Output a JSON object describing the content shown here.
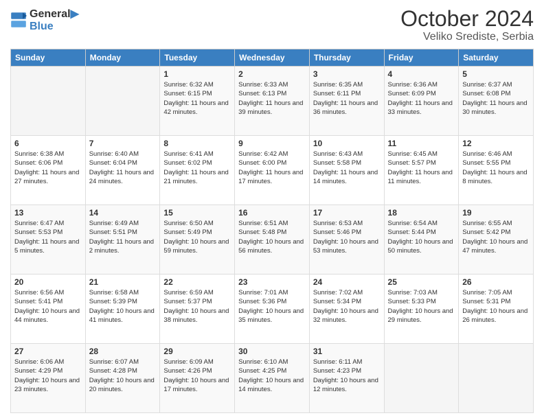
{
  "header": {
    "logo_line1": "General",
    "logo_line2": "Blue",
    "month": "October 2024",
    "location": "Veliko Srediste, Serbia"
  },
  "weekdays": [
    "Sunday",
    "Monday",
    "Tuesday",
    "Wednesday",
    "Thursday",
    "Friday",
    "Saturday"
  ],
  "weeks": [
    [
      {
        "day": "",
        "info": ""
      },
      {
        "day": "",
        "info": ""
      },
      {
        "day": "1",
        "info": "Sunrise: 6:32 AM\nSunset: 6:15 PM\nDaylight: 11 hours and 42 minutes."
      },
      {
        "day": "2",
        "info": "Sunrise: 6:33 AM\nSunset: 6:13 PM\nDaylight: 11 hours and 39 minutes."
      },
      {
        "day": "3",
        "info": "Sunrise: 6:35 AM\nSunset: 6:11 PM\nDaylight: 11 hours and 36 minutes."
      },
      {
        "day": "4",
        "info": "Sunrise: 6:36 AM\nSunset: 6:09 PM\nDaylight: 11 hours and 33 minutes."
      },
      {
        "day": "5",
        "info": "Sunrise: 6:37 AM\nSunset: 6:08 PM\nDaylight: 11 hours and 30 minutes."
      }
    ],
    [
      {
        "day": "6",
        "info": "Sunrise: 6:38 AM\nSunset: 6:06 PM\nDaylight: 11 hours and 27 minutes."
      },
      {
        "day": "7",
        "info": "Sunrise: 6:40 AM\nSunset: 6:04 PM\nDaylight: 11 hours and 24 minutes."
      },
      {
        "day": "8",
        "info": "Sunrise: 6:41 AM\nSunset: 6:02 PM\nDaylight: 11 hours and 21 minutes."
      },
      {
        "day": "9",
        "info": "Sunrise: 6:42 AM\nSunset: 6:00 PM\nDaylight: 11 hours and 17 minutes."
      },
      {
        "day": "10",
        "info": "Sunrise: 6:43 AM\nSunset: 5:58 PM\nDaylight: 11 hours and 14 minutes."
      },
      {
        "day": "11",
        "info": "Sunrise: 6:45 AM\nSunset: 5:57 PM\nDaylight: 11 hours and 11 minutes."
      },
      {
        "day": "12",
        "info": "Sunrise: 6:46 AM\nSunset: 5:55 PM\nDaylight: 11 hours and 8 minutes."
      }
    ],
    [
      {
        "day": "13",
        "info": "Sunrise: 6:47 AM\nSunset: 5:53 PM\nDaylight: 11 hours and 5 minutes."
      },
      {
        "day": "14",
        "info": "Sunrise: 6:49 AM\nSunset: 5:51 PM\nDaylight: 11 hours and 2 minutes."
      },
      {
        "day": "15",
        "info": "Sunrise: 6:50 AM\nSunset: 5:49 PM\nDaylight: 10 hours and 59 minutes."
      },
      {
        "day": "16",
        "info": "Sunrise: 6:51 AM\nSunset: 5:48 PM\nDaylight: 10 hours and 56 minutes."
      },
      {
        "day": "17",
        "info": "Sunrise: 6:53 AM\nSunset: 5:46 PM\nDaylight: 10 hours and 53 minutes."
      },
      {
        "day": "18",
        "info": "Sunrise: 6:54 AM\nSunset: 5:44 PM\nDaylight: 10 hours and 50 minutes."
      },
      {
        "day": "19",
        "info": "Sunrise: 6:55 AM\nSunset: 5:42 PM\nDaylight: 10 hours and 47 minutes."
      }
    ],
    [
      {
        "day": "20",
        "info": "Sunrise: 6:56 AM\nSunset: 5:41 PM\nDaylight: 10 hours and 44 minutes."
      },
      {
        "day": "21",
        "info": "Sunrise: 6:58 AM\nSunset: 5:39 PM\nDaylight: 10 hours and 41 minutes."
      },
      {
        "day": "22",
        "info": "Sunrise: 6:59 AM\nSunset: 5:37 PM\nDaylight: 10 hours and 38 minutes."
      },
      {
        "day": "23",
        "info": "Sunrise: 7:01 AM\nSunset: 5:36 PM\nDaylight: 10 hours and 35 minutes."
      },
      {
        "day": "24",
        "info": "Sunrise: 7:02 AM\nSunset: 5:34 PM\nDaylight: 10 hours and 32 minutes."
      },
      {
        "day": "25",
        "info": "Sunrise: 7:03 AM\nSunset: 5:33 PM\nDaylight: 10 hours and 29 minutes."
      },
      {
        "day": "26",
        "info": "Sunrise: 7:05 AM\nSunset: 5:31 PM\nDaylight: 10 hours and 26 minutes."
      }
    ],
    [
      {
        "day": "27",
        "info": "Sunrise: 6:06 AM\nSunset: 4:29 PM\nDaylight: 10 hours and 23 minutes."
      },
      {
        "day": "28",
        "info": "Sunrise: 6:07 AM\nSunset: 4:28 PM\nDaylight: 10 hours and 20 minutes."
      },
      {
        "day": "29",
        "info": "Sunrise: 6:09 AM\nSunset: 4:26 PM\nDaylight: 10 hours and 17 minutes."
      },
      {
        "day": "30",
        "info": "Sunrise: 6:10 AM\nSunset: 4:25 PM\nDaylight: 10 hours and 14 minutes."
      },
      {
        "day": "31",
        "info": "Sunrise: 6:11 AM\nSunset: 4:23 PM\nDaylight: 10 hours and 12 minutes."
      },
      {
        "day": "",
        "info": ""
      },
      {
        "day": "",
        "info": ""
      }
    ]
  ]
}
